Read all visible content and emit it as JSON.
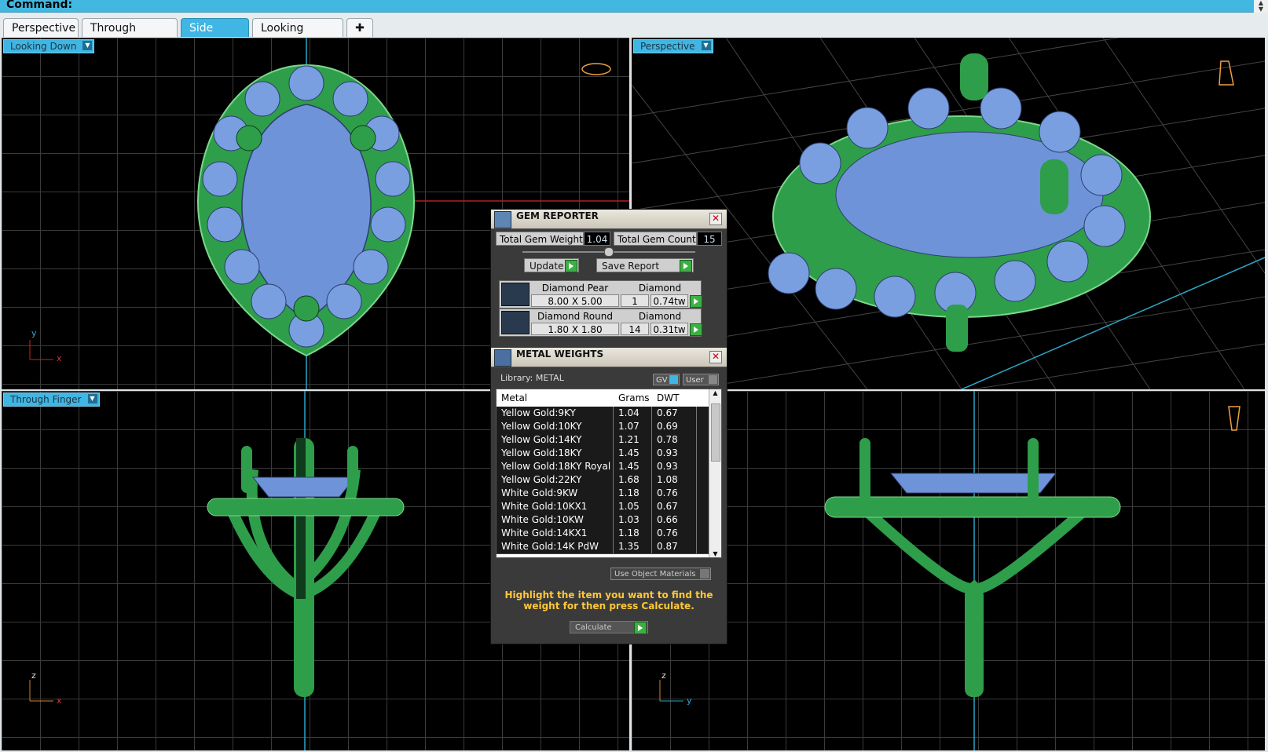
{
  "command": {
    "label": "Command:"
  },
  "tabs": [
    {
      "label": "Perspective"
    },
    {
      "label": "Through Finger"
    },
    {
      "label": "Side View"
    },
    {
      "label": "Looking Down"
    }
  ],
  "tab_add_icon": "plus-icon",
  "viewports": {
    "top_left": {
      "label": "Looking Down",
      "axis_v": "y",
      "axis_h": "x"
    },
    "top_right": {
      "label": "Perspective"
    },
    "bottom_left": {
      "label": "Through Finger",
      "axis_v": "z",
      "axis_h": "x"
    },
    "bottom_right": {
      "axis_v": "z",
      "axis_h": "y"
    }
  },
  "gem_reporter": {
    "title": "GEM REPORTER",
    "total_weight_label": "Total Gem Weight",
    "total_weight_value": "1.04",
    "total_count_label": "Total Gem Count",
    "total_count_value": "15",
    "update_label": "Update",
    "save_label": "Save Report",
    "gems": [
      {
        "name": "Diamond Pear",
        "material": "Diamond",
        "size": "8.00 X 5.00",
        "count": "1",
        "weight": "0.74tw"
      },
      {
        "name": "Diamond Round",
        "material": "Diamond",
        "size": "1.80 X 1.80",
        "count": "14",
        "weight": "0.31tw"
      }
    ]
  },
  "metal_weights": {
    "title": "METAL WEIGHTS",
    "library_label": "Library: METAL",
    "gv_label": "GV",
    "user_label": "User",
    "columns": [
      "Metal",
      "Grams",
      "DWT"
    ],
    "rows": [
      [
        "Yellow Gold:9KY",
        "1.04",
        "0.67"
      ],
      [
        "Yellow Gold:10KY",
        "1.07",
        "0.69"
      ],
      [
        "Yellow Gold:14KY",
        "1.21",
        "0.78"
      ],
      [
        "Yellow Gold:18KY",
        "1.45",
        "0.93"
      ],
      [
        "Yellow Gold:18KY Royal",
        "1.45",
        "0.93"
      ],
      [
        "Yellow Gold:22KY",
        "1.68",
        "1.08"
      ],
      [
        "White Gold:9KW",
        "1.18",
        "0.76"
      ],
      [
        "White Gold:10KX1",
        "1.05",
        "0.67"
      ],
      [
        "White Gold:10KW",
        "1.03",
        "0.66"
      ],
      [
        "White Gold:14KX1",
        "1.18",
        "0.76"
      ],
      [
        "White Gold:14K PdW",
        "1.35",
        "0.87"
      ]
    ],
    "use_object_materials_label": "Use Object Materials",
    "hint": "Highlight the item you want to find the weight for then press Calculate.",
    "calculate_label": "Calculate"
  },
  "colors": {
    "accent": "#3fb6e3",
    "metal": "#2e9e4a",
    "gem": "#7a9fe0",
    "hint": "#ffc837"
  }
}
